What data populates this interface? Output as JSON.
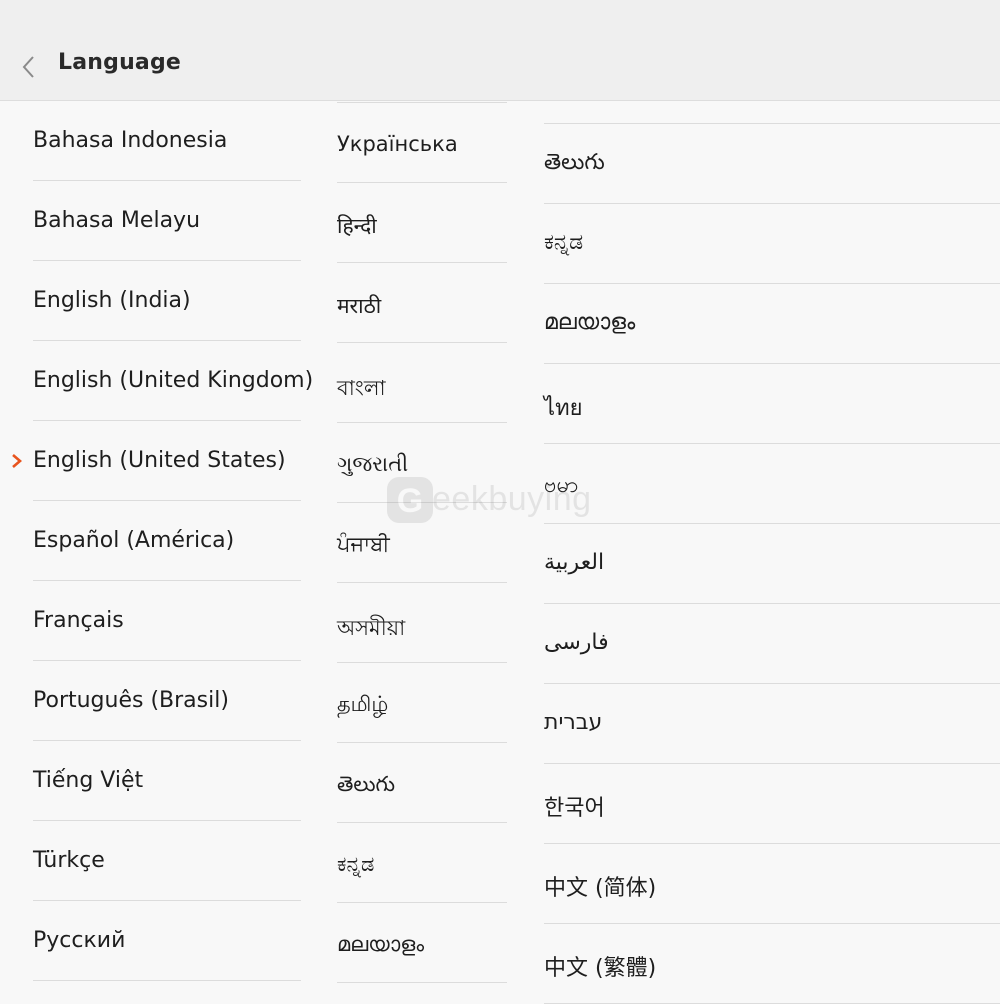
{
  "header": {
    "title": "Language",
    "back_icon": "chevron-left-icon"
  },
  "selected": {
    "icon": "chevron-right-icon",
    "color": "#e8541e"
  },
  "columns": [
    {
      "items": [
        {
          "label": "Bahasa Indonesia"
        },
        {
          "label": "Bahasa Melayu"
        },
        {
          "label": "English (India)"
        },
        {
          "label": "English (United Kingdom)"
        },
        {
          "label": "English (United States)",
          "selected": true
        },
        {
          "label": "Español (América)"
        },
        {
          "label": "Français"
        },
        {
          "label": "Português (Brasil)"
        },
        {
          "label": "Tiếng Việt"
        },
        {
          "label": "Türkçe"
        },
        {
          "label": "Русский"
        }
      ]
    },
    {
      "items": [
        {
          "label": "Українська"
        },
        {
          "label": "हिन्दी"
        },
        {
          "label": "मराठी"
        },
        {
          "label": "বাংলা"
        },
        {
          "label": "ગુજરાતી"
        },
        {
          "label": "ਪੰਜਾਬੀ"
        },
        {
          "label": "অসমীয়া"
        },
        {
          "label": "தமிழ்"
        },
        {
          "label": "తెలుగు"
        },
        {
          "label": "ಕನ್ನಡ"
        },
        {
          "label": "മലയാളം"
        }
      ]
    },
    {
      "items": [
        {
          "label": "తెలుగు"
        },
        {
          "label": "ಕನ್ನಡ"
        },
        {
          "label": "മലയാളം"
        },
        {
          "label": "ไทย"
        },
        {
          "label": "ဗမာ"
        },
        {
          "label": "العربية"
        },
        {
          "label": "فارسی"
        },
        {
          "label": "עברית"
        },
        {
          "label": "한국어"
        },
        {
          "label": "中文 (简体)"
        },
        {
          "label": "中文 (繁體)"
        }
      ]
    }
  ],
  "watermark": {
    "text": "eekbuying",
    "icon": "geekbuying-logo-icon"
  }
}
